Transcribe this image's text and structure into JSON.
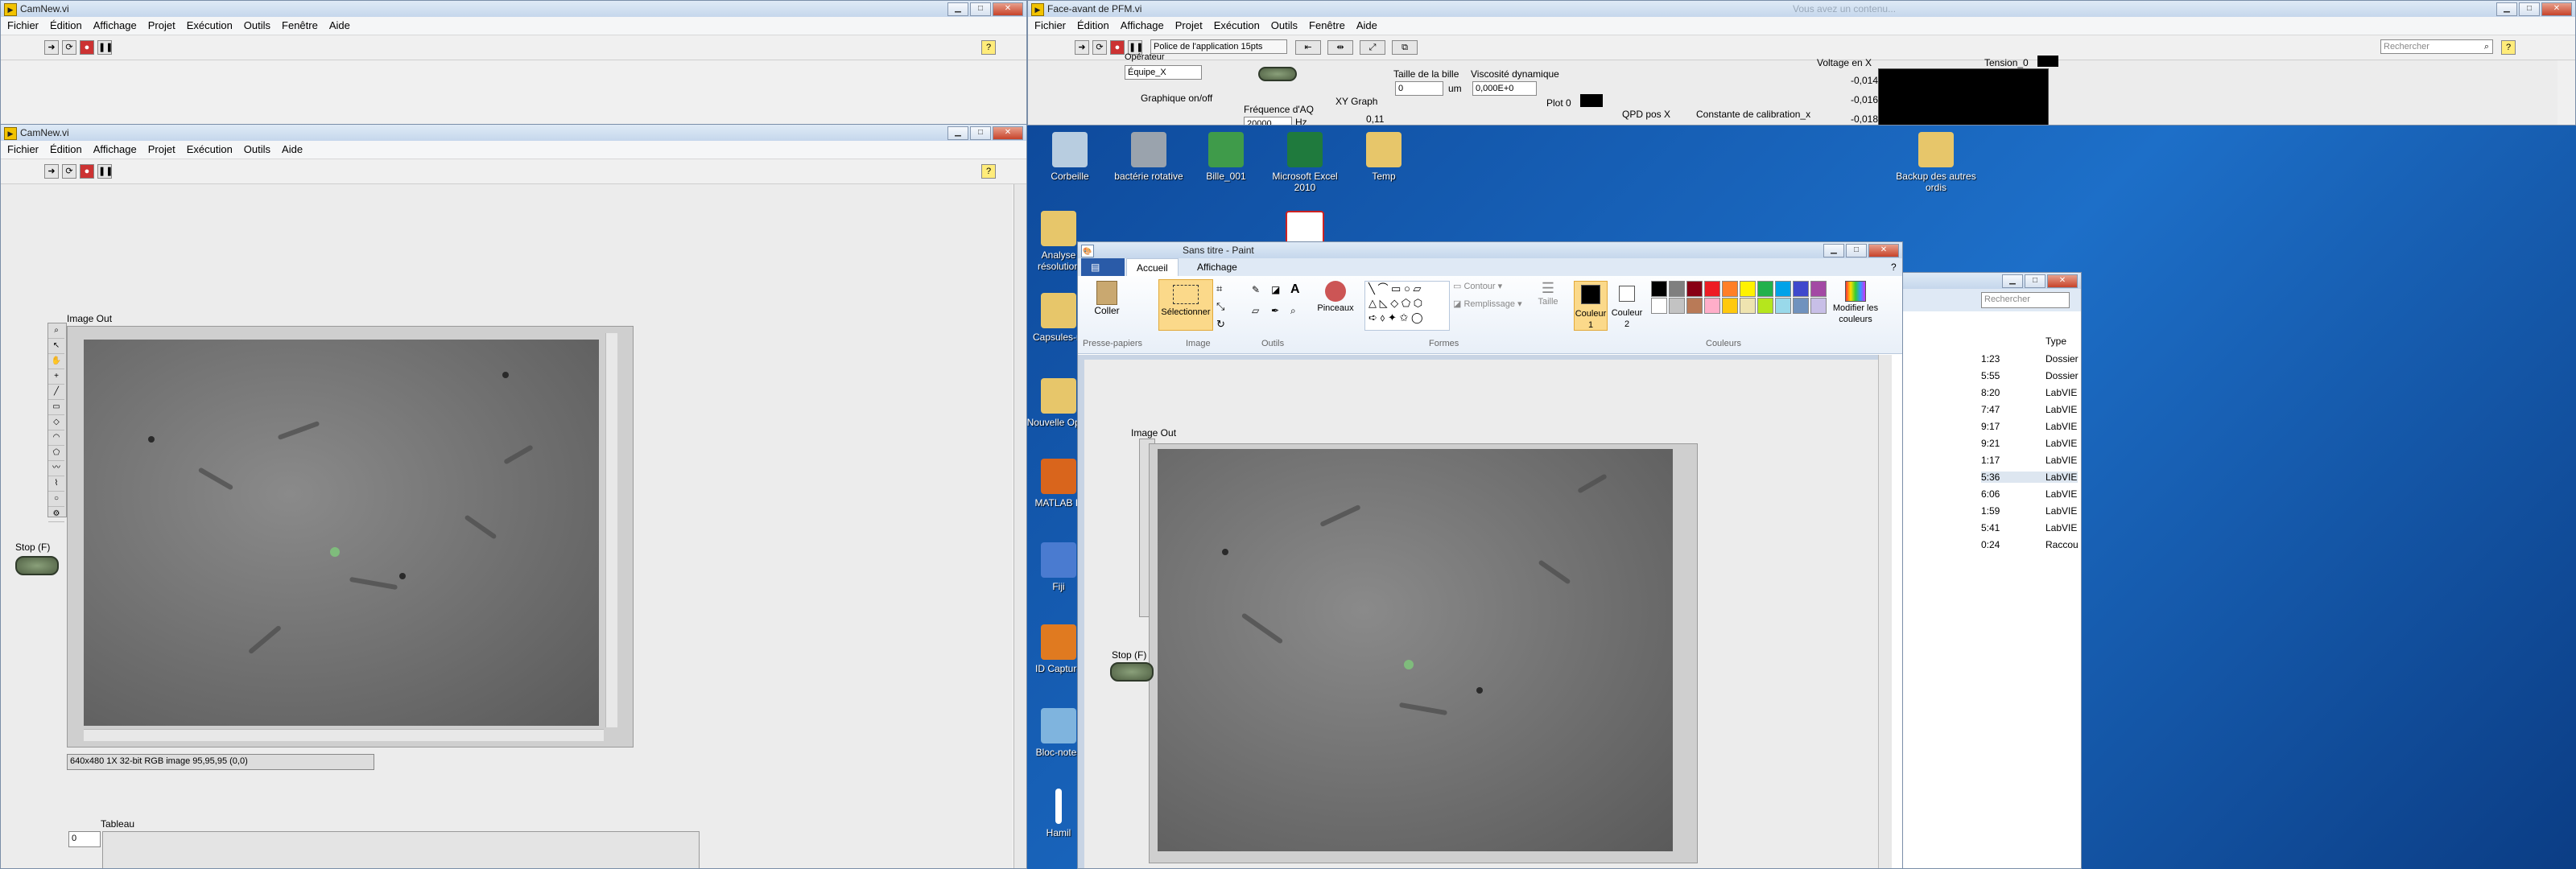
{
  "left_top_window": {
    "title": "CamNew.vi"
  },
  "left_main_window": {
    "title": "CamNew.vi",
    "menu": [
      "Fichier",
      "Édition",
      "Affichage",
      "Projet",
      "Exécution",
      "Outils",
      "Aide"
    ],
    "image_label": "Image Out",
    "stop_label": "Stop (F)",
    "status_text": "640x480 1X 32-bit RGB image 95,95,95     (0,0)",
    "tableau_label": "Tableau",
    "tableau_index": "0"
  },
  "left_top_menu": [
    "Fichier",
    "Édition",
    "Affichage",
    "Projet",
    "Exécution",
    "Outils",
    "Fenêtre",
    "Aide"
  ],
  "right_front_panel": {
    "title": "Face-avant de PFM.vi",
    "menu": [
      "Fichier",
      "Édition",
      "Affichage",
      "Projet",
      "Exécution",
      "Outils",
      "Fenêtre",
      "Aide"
    ],
    "font_select": "Police de l'application 15pts",
    "search_placeholder": "Rechercher",
    "operator_label": "Opérateur",
    "operator_value": "Équipe_X",
    "graph_toggle_label": "Graphique on/off",
    "freq_label": "Fréquence d'AQ",
    "freq_value": "20000",
    "freq_unit": "Hz",
    "xy_graph_label": "XY Graph",
    "bead_size_label": "Taille de la bille",
    "bead_size_value": "0",
    "bead_unit": "um",
    "viscosity_label": "Viscosité dynamique",
    "viscosity_value": "0,000E+0",
    "plot_label": "Plot 0",
    "y_tick": "0,11",
    "qpd_label": "QPD pos X",
    "calib_label": "Constante de calibration_x",
    "voltage_label": "Voltage en X",
    "tension_label": "Tension_0",
    "voltage_ticks": [
      "-0,014",
      "-0,016",
      "-0,018"
    ]
  },
  "desktop_icons": [
    {
      "label": "Corbeille",
      "color": "#b8cde0"
    },
    {
      "label": "bactérie rotative",
      "color": "#9aa3ad"
    },
    {
      "label": "Bille_001",
      "color": "#3f9b4a"
    },
    {
      "label": "Microsoft Excel 2010",
      "color": "#1f7a3d"
    },
    {
      "label": "Temp",
      "color": "#e7c66a"
    },
    {
      "label": "Backup des autres ordis",
      "color": "#e7c66a"
    },
    {
      "label": "Analyse résolution",
      "color": "#e7c66a"
    },
    {
      "label": "Capsules-m",
      "color": "#e7c66a"
    },
    {
      "label": "Nouvelle Optiq",
      "color": "#e7c66a"
    },
    {
      "label": "MATLAB R",
      "color": "#d9651c"
    },
    {
      "label": "Fiji",
      "color": "#4a7bd0"
    },
    {
      "label": "ID Capture",
      "color": "#e07a20"
    },
    {
      "label": "Bloc-notes",
      "color": "#7fb4de"
    },
    {
      "label": "Hamil",
      "color": "#ffffff"
    }
  ],
  "paint": {
    "title": "Sans titre - Paint",
    "tabs": [
      "Accueil",
      "Affichage"
    ],
    "groups": [
      "Presse-papiers",
      "Image",
      "Outils",
      "Formes",
      "Couleurs"
    ],
    "coller": "Coller",
    "selectionner": "Sélectionner",
    "pinceaux": "Pinceaux",
    "contour": "Contour",
    "remplissage": "Remplissage",
    "taille": "Taille",
    "couleur1": "Couleur 1",
    "couleur2": "Couleur 2",
    "modifier": "Modifier les couleurs",
    "image_label": "Image Out",
    "stop_label": "Stop (F)",
    "colors": [
      "#000000",
      "#7f7f7f",
      "#880015",
      "#ed1c24",
      "#ff7f27",
      "#fff200",
      "#22b14c",
      "#00a2e8",
      "#3f48cc",
      "#a349a4",
      "#ffffff",
      "#c3c3c3",
      "#b97a57",
      "#ffaec9",
      "#ffc90e",
      "#efe4b0",
      "#b5e61d",
      "#99d9ea",
      "#7092be",
      "#c8bfe7"
    ]
  },
  "explorer": {
    "search_placeholder": "Rechercher",
    "type_header": "Type",
    "rows": [
      {
        "time": "1:23",
        "type": "Dossier"
      },
      {
        "time": "5:55",
        "type": "Dossier"
      },
      {
        "time": "8:20",
        "type": "LabVIE"
      },
      {
        "time": "7:47",
        "type": "LabVIE"
      },
      {
        "time": "9:17",
        "type": "LabVIE"
      },
      {
        "time": "9:21",
        "type": "LabVIE"
      },
      {
        "time": "1:17",
        "type": "LabVIE"
      },
      {
        "time": "5:36",
        "type": "LabVIE"
      },
      {
        "time": "6:06",
        "type": "LabVIE"
      },
      {
        "time": "1:59",
        "type": "LabVIE"
      },
      {
        "time": "5:41",
        "type": "LabVIE"
      },
      {
        "time": "0:24",
        "type": "Raccou"
      }
    ]
  },
  "faded_text": "Vous avez un contenu..."
}
